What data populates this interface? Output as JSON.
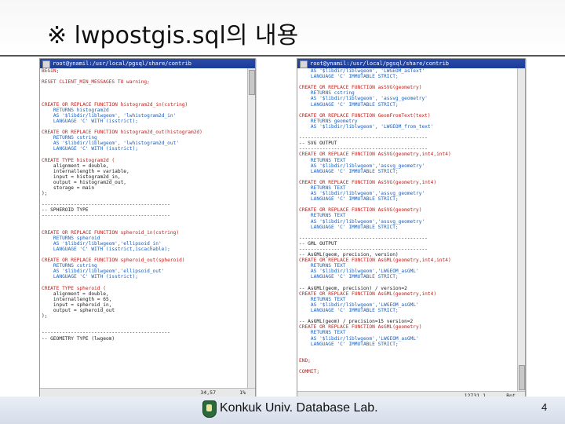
{
  "slide": {
    "title": "※ lwpostgis.sql의 내용",
    "footer": "Konkuk Univ. Database Lab.",
    "page_number": "4"
  },
  "left_terminal": {
    "title": "root@ynamil:/usr/local/pgsql/share/contrib",
    "lines": [
      "BEGIN;",
      "",
      "RESET CLIENT_MIN_MESSAGES TO warning;",
      "",
      "",
      "",
      "CREATE OR REPLACE FUNCTION histogram2d_in(cstring)",
      "    RETURNS histogram2d",
      "    AS '$libdir/liblwgeom', 'lwhistogram2d_in'",
      "    LANGUAGE 'C' WITH (isstrict);",
      "",
      "CREATE OR REPLACE FUNCTION histogram2d_out(histogram2d)",
      "    RETURNS cstring",
      "    AS '$libdir/liblwgeom', 'lwhistogram2d_out'",
      "    LANGUAGE 'C' WITH (isstrict);",
      "",
      "CREATE TYPE histogram2d (",
      "    alignment = double,",
      "    internallength = variable,",
      "    input = histogram2d_in,",
      "    output = histogram2d_out,",
      "    storage = main",
      ");",
      "",
      "--------------------------------------------",
      "-- SPHEROID TYPE",
      "--------------------------------------------",
      "",
      "",
      "CREATE OR REPLACE FUNCTION spheroid_in(cstring)",
      "    RETURNS spheroid",
      "    AS '$libdir/liblwgeom','ellipsoid_in'",
      "    LANGUAGE 'C' WITH (isstrict,iscachable);",
      "",
      "CREATE OR REPLACE FUNCTION spheroid_out(spheroid)",
      "    RETURNS cstring",
      "    AS '$libdir/liblwgeom','ellipsoid_out'",
      "    LANGUAGE 'C' WITH (isstrict);",
      "",
      "CREATE TYPE spheroid (",
      "    alignment = double,",
      "    internallength = 65,",
      "    input = spheroid_in,",
      "    output = spheroid_out",
      ");",
      "",
      "",
      "--------------------------------------------",
      "-- GEOMETRY TYPE (lwgeom)"
    ],
    "status_pos": "34,57",
    "status_pct": "1%"
  },
  "right_terminal": {
    "title": "root@ynamil:/usr/local/pgsql/share/contrib",
    "lines": [
      "    AS '$libdir/liblwgeom', 'LWGEOM_asText'",
      "    LANGUAGE 'C' IMMUTABLE STRICT;",
      "",
      "CREATE OR REPLACE FUNCTION asSVG(geometry)",
      "    RETURNS cstring",
      "    AS '$libdir/liblwgeom', 'assvg_geometry'",
      "    LANGUAGE 'C' IMMUTABLE STRICT;",
      "",
      "CREATE OR REPLACE FUNCTION GeomFromText(text)",
      "    RETURNS geometry",
      "    AS '$libdir/liblwgeom', 'LWGEOM_from_text'",
      "",
      "--------------------------------------------",
      "-- SVG OUTPUT",
      "--------------------------------------------",
      "CREATE OR REPLACE FUNCTION AsSVG(geometry,int4,int4)",
      "    RETURNS TEXT",
      "    AS '$libdir/liblwgeom','assvg_geometry'",
      "    LANGUAGE 'C' IMMUTABLE STRICT;",
      "",
      "CREATE OR REPLACE FUNCTION AsSVG(geometry,int4)",
      "    RETURNS TEXT",
      "    AS '$libdir/liblwgeom','assvg_geometry'",
      "    LANGUAGE 'C' IMMUTABLE STRICT;",
      "",
      "CREATE OR REPLACE FUNCTION AsSVG(geometry)",
      "    RETURNS TEXT",
      "    AS '$libdir/liblwgeom','assvg_geometry'",
      "    LANGUAGE 'C' IMMUTABLE STRICT;",
      "",
      "--------------------------------------------",
      "-- GML OUTPUT",
      "--------------------------------------------",
      "-- AsGML(geom, precision, version)",
      "CREATE OR REPLACE FUNCTION AsGML(geometry,int4,int4)",
      "    RETURNS TEXT",
      "    AS '$libdir/liblwgeom','LWGEOM_asGML'",
      "    LANGUAGE 'C' IMMUTABLE STRICT;",
      "",
      "-- AsGML(geom, precision) / version=2",
      "CREATE OR REPLACE FUNCTION AsGML(geometry,int4)",
      "    RETURNS TEXT",
      "    AS '$libdir/liblwgeom','LWGEOM_asGML'",
      "    LANGUAGE 'C' IMMUTABLE STRICT;",
      "",
      "-- AsGML(geom) / precision=15 version=2",
      "CREATE OR REPLACE FUNCTION AsGML(geometry)",
      "    RETURNS TEXT",
      "    AS '$libdir/liblwgeom','LWGEOM_asGML'",
      "    LANGUAGE 'C' IMMUTABLE STRICT;",
      "",
      "",
      "END;",
      "",
      "COMMIT;"
    ],
    "status_pos": "12731,1",
    "status_pct": "Bot"
  }
}
